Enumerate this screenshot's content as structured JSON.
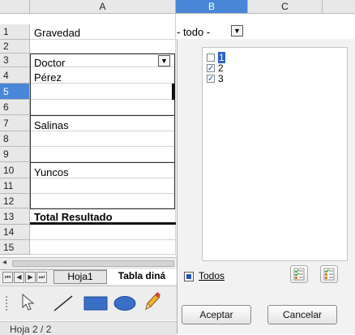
{
  "columns": [
    "A",
    "B",
    "C"
  ],
  "rows": [
    "1",
    "2",
    "3",
    "4",
    "5",
    "6",
    "7",
    "8",
    "9",
    "10",
    "11",
    "12",
    "13",
    "14",
    "15"
  ],
  "cells": {
    "a1": "Gravedad",
    "b1": "- todo -",
    "a3": "Doctor",
    "a4": "Pérez",
    "a7": "Salinas",
    "a10": "Yuncos",
    "a13": "Total Resultado"
  },
  "popup": {
    "items": [
      {
        "label": "1",
        "checked": false
      },
      {
        "label": "2",
        "checked": true
      },
      {
        "label": "3",
        "checked": true
      }
    ],
    "all_label": "Todos",
    "accept_label": "Aceptar",
    "cancel_label": "Cancelar"
  },
  "sheet_tabs": [
    "Hoja1",
    "Tabla diná"
  ],
  "status": {
    "sheet": "Hoja 2 / 2"
  },
  "colors": {
    "selection": "#4a86d8",
    "checkbox_check": "#1a4fa0"
  }
}
